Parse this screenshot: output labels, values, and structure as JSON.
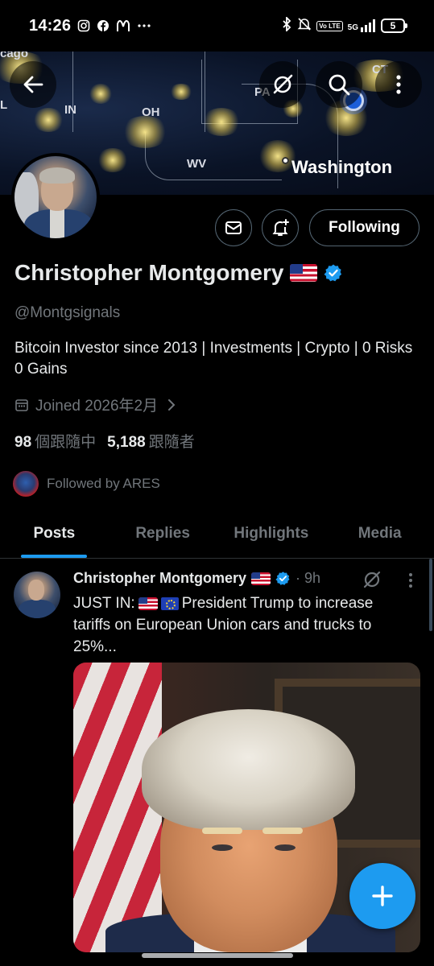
{
  "status_bar": {
    "time": "14:26",
    "app_icons": [
      "instagram-icon",
      "facebook-icon",
      "mcdonalds-icon",
      "more-icon"
    ],
    "volte": "Vo LTE",
    "network": "5G",
    "battery": "5"
  },
  "banner": {
    "map_labels": [
      "cago",
      "IN",
      "OH",
      "PA",
      "WV",
      "CT",
      "L"
    ],
    "city_label": "Washington"
  },
  "profile": {
    "name": "Christopher Montgomery",
    "handle": "@Montgsignals",
    "bio": "Bitcoin Investor since 2013 | Investments | Crypto | 0 Risks 0 Gains",
    "joined": "Joined 2026年2月",
    "following_count": "98",
    "following_label": "個跟隨中",
    "followers_count": "5,188",
    "followers_label": "跟隨者",
    "followed_by": "Followed by ARES",
    "follow_button": "Following"
  },
  "tabs": [
    "Posts",
    "Replies",
    "Highlights",
    "Media"
  ],
  "active_tab": "Posts",
  "tweet": {
    "author": "Christopher Montgomery",
    "time": "· 9h",
    "text_prefix": "JUST IN:",
    "text_line1": "President Trump to increase",
    "text_line2": "tariffs on European Union cars and trucks to",
    "text_line3": "25%..."
  },
  "colors": {
    "accent": "#1d9bf0",
    "secondary_text": "#71767b",
    "border": "#2f3336"
  }
}
